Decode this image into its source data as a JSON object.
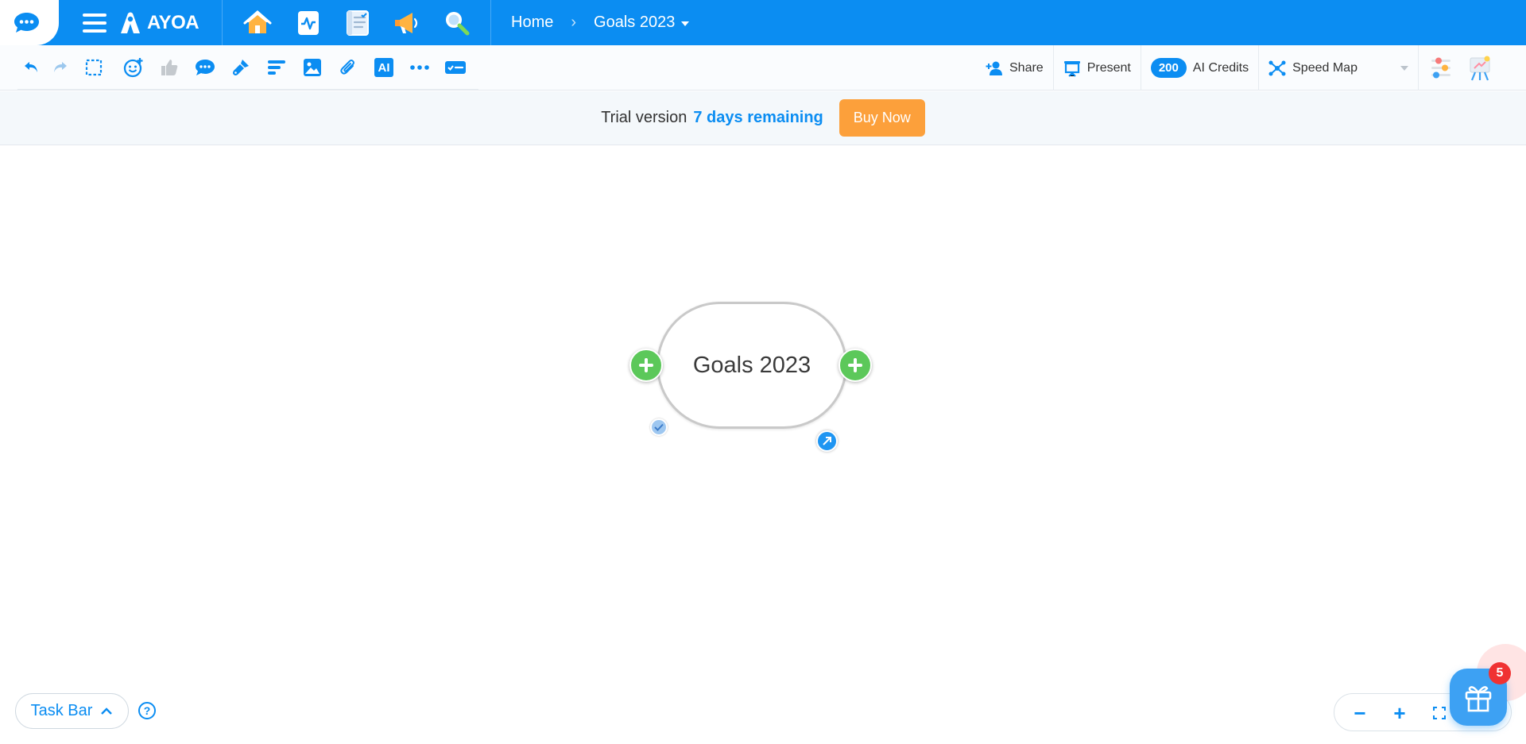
{
  "app": {
    "brand": "AYOA",
    "accent": "#0b8df2"
  },
  "topbar": {
    "nav_icons": [
      "home-icon",
      "activity-icon",
      "notebook-icon",
      "announcement-icon",
      "search-icon"
    ],
    "breadcrumb": {
      "home": "Home",
      "separator": "›",
      "current": "Goals 2023"
    }
  },
  "toolbar": {
    "tools": [
      "undo-icon",
      "redo-icon",
      "select-icon",
      "add-emoji-icon",
      "like-icon",
      "comment-icon",
      "format-painter-icon",
      "align-icon",
      "image-icon",
      "attachment-icon",
      "ai-icon",
      "more-icon",
      "task-card-icon"
    ],
    "ai_label": "AI",
    "share_label": "Share",
    "present_label": "Present",
    "ai_credits_count": "200",
    "ai_credits_label": "AI Credits",
    "map_type_label": "Speed Map"
  },
  "trial": {
    "prefix": "Trial version",
    "days": "7 days remaining",
    "buy_label": "Buy Now",
    "button_color": "#fca03b"
  },
  "canvas": {
    "central_node": "Goals 2023",
    "branch_color": "#5cc85a"
  },
  "bottom": {
    "taskbar_label": "Task Bar",
    "help_label": "?",
    "zoom_out": "−",
    "zoom_in": "+",
    "gift_badge": "5"
  }
}
